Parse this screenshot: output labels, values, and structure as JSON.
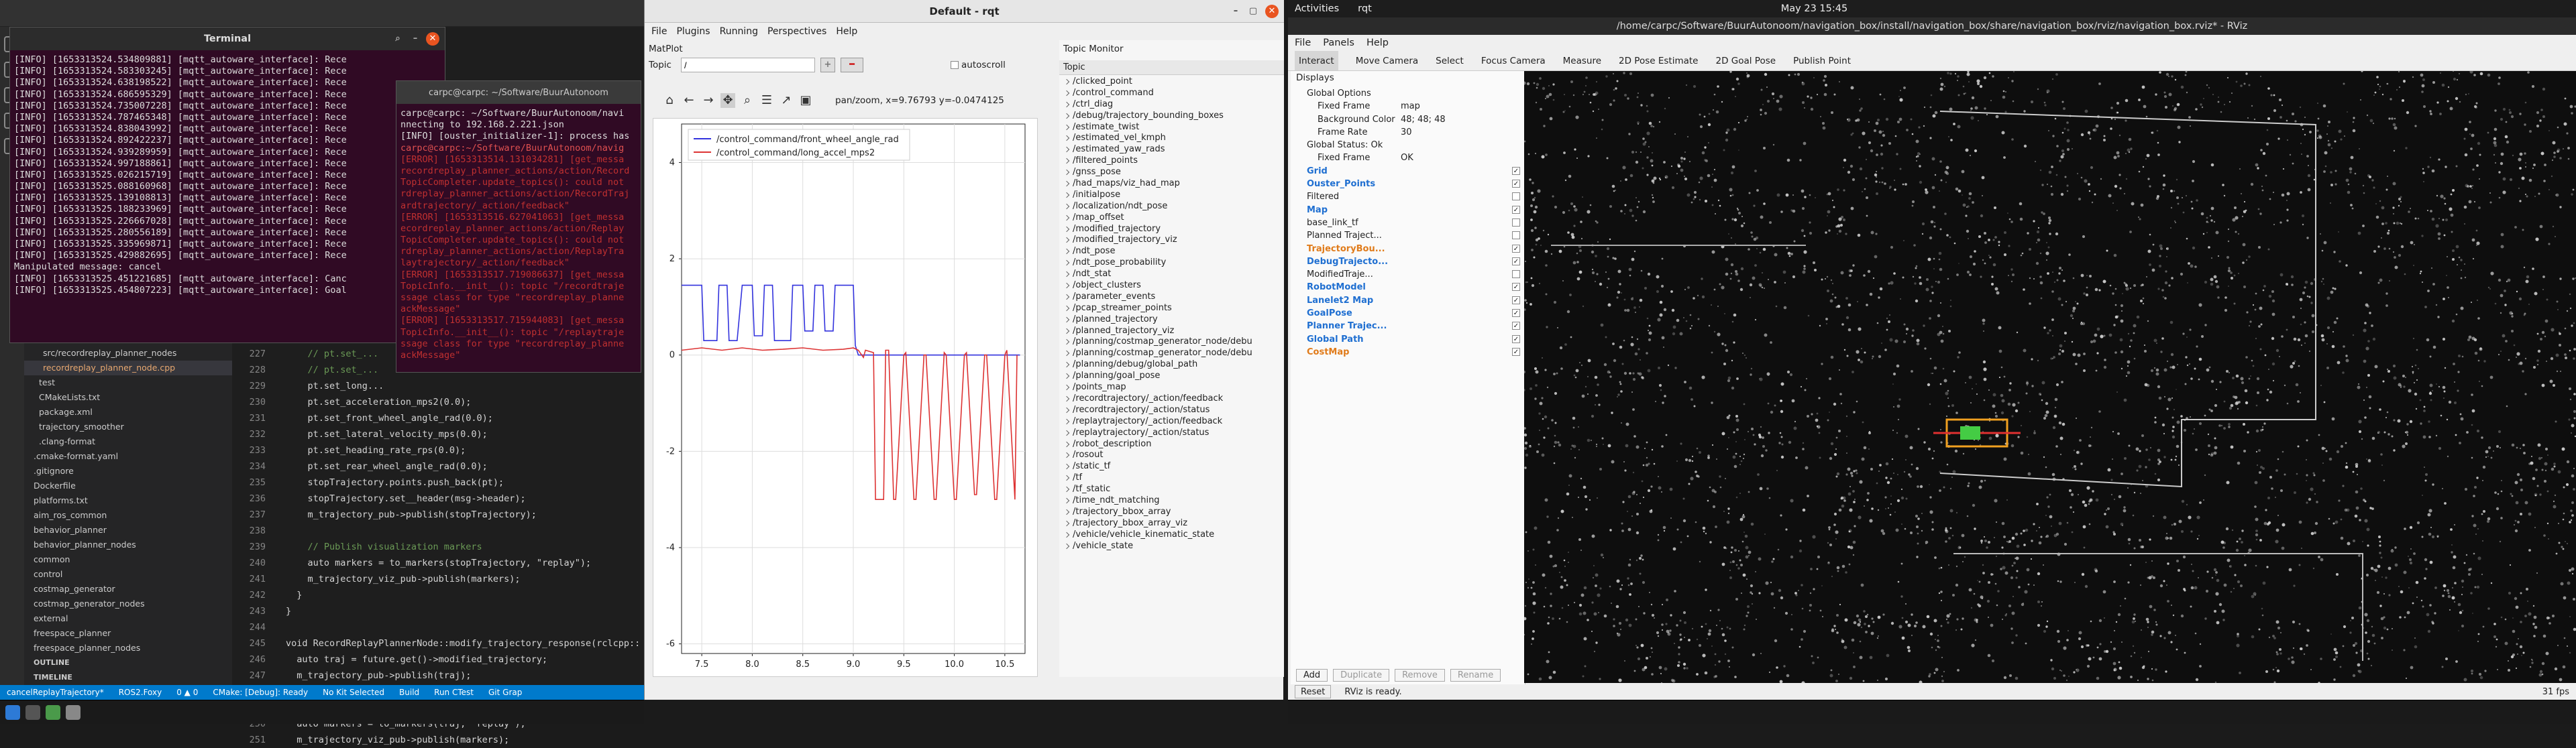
{
  "vscode": {
    "sidebar_items": [
      "src/recordreplay_planner_nodes",
      "recordreplay_planner_node.cpp",
      "test",
      "CMakeLists.txt",
      "package.xml",
      "trajectory_smoother",
      ".clang-format",
      ".cmake-format.yaml",
      ".gitignore",
      "Dockerfile",
      "platforms.txt",
      "aim_ros_common",
      "behavior_planner",
      "behavior_planner_nodes",
      "common",
      "control",
      "costmap_generator",
      "costmap_generator_nodes",
      "external",
      "freespace_planner",
      "freespace_planner_nodes",
      "OUTLINE",
      "TIMELINE"
    ],
    "code_lines": [
      {
        "n": "227",
        "t": "    // pt.set_..."
      },
      {
        "n": "228",
        "t": "    // pt.set_..."
      },
      {
        "n": "229",
        "t": "    pt.set_long..."
      },
      {
        "n": "230",
        "t": "    pt.set_acceleration_mps2(0.0);"
      },
      {
        "n": "231",
        "t": "    pt.set_front_wheel_angle_rad(0.0);"
      },
      {
        "n": "232",
        "t": "    pt.set_lateral_velocity_mps(0.0);"
      },
      {
        "n": "233",
        "t": "    pt.set_heading_rate_rps(0.0);"
      },
      {
        "n": "234",
        "t": "    pt.set_rear_wheel_angle_rad(0.0);"
      },
      {
        "n": "235",
        "t": "    stopTrajectory.points.push_back(pt);"
      },
      {
        "n": "236",
        "t": "    stopTrajectory.set__header(msg->header);"
      },
      {
        "n": "237",
        "t": "    m_trajectory_pub->publish(stopTrajectory);"
      },
      {
        "n": "238",
        "t": ""
      },
      {
        "n": "239",
        "t": "    // Publish visualization markers"
      },
      {
        "n": "240",
        "t": "    auto markers = to_markers(stopTrajectory, \"replay\");"
      },
      {
        "n": "241",
        "t": "    m_trajectory_viz_pub->publish(markers);"
      },
      {
        "n": "242",
        "t": "  }"
      },
      {
        "n": "243",
        "t": "}"
      },
      {
        "n": "244",
        "t": ""
      },
      {
        "n": "245",
        "t": "void RecordReplayPlannerNode::modify_trajectory_response(rclcpp::"
      },
      {
        "n": "246",
        "t": "  auto traj = future.get()->modified_trajectory;"
      },
      {
        "n": "247",
        "t": "  m_trajectory_pub->publish(traj);"
      },
      {
        "n": "248",
        "t": ""
      },
      {
        "n": "249",
        "t": "  // Publish visualization markers"
      },
      {
        "n": "250",
        "t": "  auto markers = to_markers(traj, \"replay\");"
      },
      {
        "n": "251",
        "t": "  m_trajectory_viz_pub->publish(markers);"
      }
    ],
    "status_items": [
      "cancelReplayTrajectory*",
      "ROS2.Foxy",
      "0 ▲ 0",
      "CMake: [Debug]: Ready",
      "No Kit Selected",
      "Build",
      "Run CTest"
    ],
    "status_trail": "Git Grap"
  },
  "terminal1": {
    "title": "Terminal",
    "lines": [
      "[INFO] [1653313524.534809881] [mqtt_autoware_interface]: Rece",
      "[INFO] [1653313524.583303245] [mqtt_autoware_interface]: Rece",
      "[INFO] [1653313524.638198522] [mqtt_autoware_interface]: Rece",
      "[INFO] [1653313524.686595329] [mqtt_autoware_interface]: Rece",
      "[INFO] [1653313524.735007228] [mqtt_autoware_interface]: Rece",
      "[INFO] [1653313524.787465348] [mqtt_autoware_interface]: Rece",
      "[INFO] [1653313524.838043992] [mqtt_autoware_interface]: Rece",
      "[INFO] [1653313524.892422237] [mqtt_autoware_interface]: Rece",
      "[INFO] [1653313524.939289959] [mqtt_autoware_interface]: Rece",
      "[INFO] [1653313524.997188861] [mqtt_autoware_interface]: Rece",
      "[INFO] [1653313525.026215719] [mqtt_autoware_interface]: Rece",
      "[INFO] [1653313525.088160968] [mqtt_autoware_interface]: Rece",
      "[INFO] [1653313525.139108813] [mqtt_autoware_interface]: Rece",
      "[INFO] [1653313525.188233969] [mqtt_autoware_interface]: Rece",
      "[INFO] [1653313525.226667028] [mqtt_autoware_interface]: Rece",
      "[INFO] [1653313525.280556189] [mqtt_autoware_interface]: Rece",
      "[INFO] [1653313525.335969871] [mqtt_autoware_interface]: Rece",
      "[INFO] [1653313525.429882695] [mqtt_autoware_interface]: Rece",
      "Manipulated message: cancel",
      "[INFO] [1653313525.451221685] [mqtt_autoware_interface]: Canc",
      "[INFO] [1653313525.454807223] [mqtt_autoware_interface]: Goal"
    ]
  },
  "terminal2": {
    "title": "carpc@carpc: ~/Software/BuurAutonoom",
    "lines": [
      {
        "t": "carpc@carpc: ~/Software/BuurAutonoom/navi",
        "c": "#ddd"
      },
      {
        "t": "nnecting to 192.168.2.221.json",
        "c": "#ddd"
      },
      {
        "t": "[INFO] [ouster_initializer-1]: process has",
        "c": "#ddd"
      },
      {
        "t": "carpc@carpc:~/Software/BuurAutonoom/navig",
        "c": "#e05050"
      },
      {
        "t": "[ERROR] [1653313514.131034281] [get_messa",
        "c": "#c03030"
      },
      {
        "t": "recordreplay_planner_actions/action/Record",
        "c": "#c03030"
      },
      {
        "t": "TopicCompleter.update_topics(): could not",
        "c": "#c03030"
      },
      {
        "t": "rdreplay_planner_actions/action/RecordTraj",
        "c": "#c03030"
      },
      {
        "t": "ardtrajectory/_action/feedback\"",
        "c": "#c03030"
      },
      {
        "t": "[ERROR] [1653313516.627041063] [get_messa",
        "c": "#c03030"
      },
      {
        "t": "ecordreplay_planner_actions/action/Replay",
        "c": "#c03030"
      },
      {
        "t": "TopicCompleter.update_topics(): could not",
        "c": "#c03030"
      },
      {
        "t": "rdreplay_planner_actions/action/ReplayTra",
        "c": "#c03030"
      },
      {
        "t": "laytrajectory/_action/feedback\"",
        "c": "#c03030"
      },
      {
        "t": "[ERROR] [1653313517.719086637] [get_messa",
        "c": "#c03030"
      },
      {
        "t": "TopicInfo.__init__(): topic \"/recordtraje",
        "c": "#c03030"
      },
      {
        "t": "ssage class for type \"recordreplay_planne",
        "c": "#c03030"
      },
      {
        "t": "ackMessage\"",
        "c": "#c03030"
      },
      {
        "t": "[ERROR] [1653313517.715944083] [get_messa",
        "c": "#c03030"
      },
      {
        "t": "TopicInfo.__init__(): topic \"/replaytraje",
        "c": "#c03030"
      },
      {
        "t": "ssage class for type \"recordreplay_planne",
        "c": "#c03030"
      },
      {
        "t": "ackMessage\"",
        "c": "#c03030"
      }
    ]
  },
  "rqt": {
    "title": "Default - rqt",
    "menu": [
      "File",
      "Plugins",
      "Running",
      "Perspectives",
      "Help"
    ],
    "matplot_title": "MatPlot",
    "topic_label": "Topic",
    "topic_value": "/",
    "autoscroll_label": "autoscroll",
    "toolbar_readout": "pan/zoom, x=9.76793     y=-0.0474125",
    "topic_monitor_title": "Topic Monitor",
    "topic_header": "Topic",
    "topics": [
      "/clicked_point",
      "/control_command",
      "/ctrl_diag",
      "/debug/trajectory_bounding_boxes",
      "/estimate_twist",
      "/estimated_vel_kmph",
      "/estimated_yaw_rads",
      "/filtered_points",
      "/gnss_pose",
      "/had_maps/viz_had_map",
      "/initialpose",
      "/localization/ndt_pose",
      "/map_offset",
      "/modified_trajectory",
      "/modified_trajectory_viz",
      "/ndt_pose",
      "/ndt_pose_probability",
      "/ndt_stat",
      "/object_clusters",
      "/parameter_events",
      "/pcap_streamer_points",
      "/planned_trajectory",
      "/planned_trajectory_viz",
      "/planning/costmap_generator_node/debu",
      "/planning/costmap_generator_node/debu",
      "/planning/debug/global_path",
      "/planning/goal_pose",
      "/points_map",
      "/recordtrajectory/_action/feedback",
      "/recordtrajectory/_action/status",
      "/replaytrajectory/_action/feedback",
      "/replaytrajectory/_action/status",
      "/robot_description",
      "/rosout",
      "/static_tf",
      "/tf",
      "/tf_static",
      "/time_ndt_matching",
      "/trajectory_bbox_array",
      "/trajectory_bbox_array_viz",
      "/vehicle/vehicle_kinematic_state",
      "/vehicle_state"
    ]
  },
  "chart_data": {
    "type": "line",
    "xlim": [
      7.3,
      10.7
    ],
    "ylim": [
      -6.2,
      4.8
    ],
    "xticks": [
      7.5,
      8.0,
      8.5,
      9.0,
      9.5,
      10.0,
      10.5
    ],
    "yticks": [
      4,
      2,
      0,
      -2,
      -4,
      -6
    ],
    "legend_position": "top-left",
    "series": [
      {
        "name": "/control_command/front_wheel_angle_rad",
        "color": "#3333dd",
        "x": [
          7.3,
          7.5,
          7.52,
          7.65,
          7.67,
          7.75,
          7.77,
          7.85,
          7.9,
          7.92,
          8.0,
          8.02,
          8.1,
          8.12,
          8.2,
          8.22,
          8.38,
          8.4,
          8.5,
          8.52,
          8.6,
          8.62,
          8.7,
          8.72,
          8.8,
          8.82,
          8.9,
          8.92,
          9.0,
          9.02,
          9.05,
          9.1,
          9.3,
          9.5,
          9.7,
          9.9,
          10.1,
          10.3,
          10.5,
          10.65
        ],
        "y": [
          1.45,
          1.45,
          0.3,
          0.3,
          1.45,
          1.45,
          0.3,
          0.3,
          1.45,
          1.45,
          1.45,
          0.4,
          0.4,
          1.45,
          1.45,
          0.3,
          0.3,
          1.45,
          1.45,
          0.5,
          0.5,
          1.45,
          1.45,
          0.5,
          0.5,
          1.45,
          1.45,
          1.45,
          1.45,
          0.2,
          0.0,
          0.0,
          0.0,
          0.0,
          0.0,
          0.0,
          0.0,
          0.0,
          0.0,
          0.0
        ]
      },
      {
        "name": "/control_command/long_accel_mps2",
        "color": "#dd3333",
        "x": [
          7.3,
          7.5,
          7.7,
          7.9,
          8.1,
          8.3,
          8.5,
          8.7,
          8.9,
          9.0,
          9.05,
          9.1,
          9.12,
          9.2,
          9.22,
          9.3,
          9.32,
          9.35,
          9.4,
          9.42,
          9.5,
          9.52,
          9.6,
          9.62,
          9.7,
          9.72,
          9.8,
          9.82,
          9.9,
          9.92,
          10.0,
          10.02,
          10.1,
          10.12,
          10.2,
          10.22,
          10.3,
          10.32,
          10.4,
          10.42,
          10.5,
          10.52,
          10.6,
          10.62
        ],
        "y": [
          0.1,
          0.15,
          0.1,
          0.15,
          0.1,
          0.12,
          0.15,
          0.1,
          0.12,
          0.15,
          0.1,
          -0.05,
          0.1,
          0.05,
          -3.0,
          -3.0,
          0.1,
          0.1,
          -3.0,
          -3.0,
          0.0,
          0.05,
          -3.0,
          -3.0,
          0.0,
          0.0,
          -3.0,
          -3.0,
          0.05,
          0.0,
          -3.0,
          -3.0,
          0.0,
          0.05,
          -2.9,
          -2.9,
          0.0,
          0.0,
          -3.0,
          -3.0,
          0.0,
          0.1,
          -3.0,
          0.0
        ]
      }
    ]
  },
  "topbar": {
    "activities": "Activities",
    "app": "rqt",
    "clock": "May 23  15:45"
  },
  "rviz": {
    "title": "/home/carpc/Software/BuurAutonoom/navigation_box/install/navigation_box/share/navigation_box/rviz/navigation_box.rviz* - RViz",
    "menu": [
      "File",
      "Panels",
      "Help"
    ],
    "tools": [
      "Interact",
      "Move Camera",
      "Select",
      "Focus Camera",
      "Measure",
      "2D Pose Estimate",
      "2D Goal Pose",
      "Publish Point"
    ],
    "displays_title": "Displays",
    "displays": [
      {
        "label": "Global Options",
        "indent": 1,
        "bold": false,
        "color": "#222",
        "check": ""
      },
      {
        "label": "Fixed Frame",
        "indent": 2,
        "bold": false,
        "color": "#222",
        "check": "",
        "value": "map"
      },
      {
        "label": "Background Color",
        "indent": 2,
        "bold": false,
        "color": "#222",
        "check": "",
        "value": "48; 48; 48"
      },
      {
        "label": "Frame Rate",
        "indent": 2,
        "bold": false,
        "color": "#222",
        "check": "",
        "value": "30"
      },
      {
        "label": "Global Status: Ok",
        "indent": 1,
        "bold": false,
        "color": "#222",
        "check": ""
      },
      {
        "label": "Fixed Frame",
        "indent": 2,
        "bold": false,
        "color": "#222",
        "check": "",
        "value": "OK"
      },
      {
        "label": "Grid",
        "indent": 1,
        "bold": true,
        "color": "#1f6fd1",
        "check": "x"
      },
      {
        "label": "Ouster_Points",
        "indent": 1,
        "bold": true,
        "color": "#1f6fd1",
        "check": "x"
      },
      {
        "label": "Filtered",
        "indent": 1,
        "bold": false,
        "color": "#222",
        "check": "o"
      },
      {
        "label": "Map",
        "indent": 1,
        "bold": true,
        "color": "#1f6fd1",
        "check": "x"
      },
      {
        "label": "base_link_tf",
        "indent": 1,
        "bold": false,
        "color": "#222",
        "check": "o"
      },
      {
        "label": "Planned Traject...",
        "indent": 1,
        "bold": false,
        "color": "#222",
        "check": "o"
      },
      {
        "label": "TrajectoryBou...",
        "indent": 1,
        "bold": true,
        "color": "#e07b1a",
        "check": "x"
      },
      {
        "label": "DebugTrajecto...",
        "indent": 1,
        "bold": true,
        "color": "#1f6fd1",
        "check": "x"
      },
      {
        "label": "ModifiedTraje...",
        "indent": 1,
        "bold": false,
        "color": "#222",
        "check": "o"
      },
      {
        "label": "RobotModel",
        "indent": 1,
        "bold": true,
        "color": "#1f6fd1",
        "check": "x"
      },
      {
        "label": "Lanelet2 Map",
        "indent": 1,
        "bold": true,
        "color": "#1f6fd1",
        "check": "x"
      },
      {
        "label": "GoalPose",
        "indent": 1,
        "bold": true,
        "color": "#1f6fd1",
        "check": "x"
      },
      {
        "label": "Planner Trajec...",
        "indent": 1,
        "bold": true,
        "color": "#1f6fd1",
        "check": "x"
      },
      {
        "label": "Global Path",
        "indent": 1,
        "bold": true,
        "color": "#1f6fd1",
        "check": "x"
      },
      {
        "label": "CostMap",
        "indent": 1,
        "bold": true,
        "color": "#e07b1a",
        "check": "x"
      }
    ],
    "buttons": [
      "Add",
      "Duplicate",
      "Remove",
      "Rename"
    ],
    "status_reset": "Reset",
    "status_text": "RViz is ready.",
    "fps": "31 fps"
  }
}
